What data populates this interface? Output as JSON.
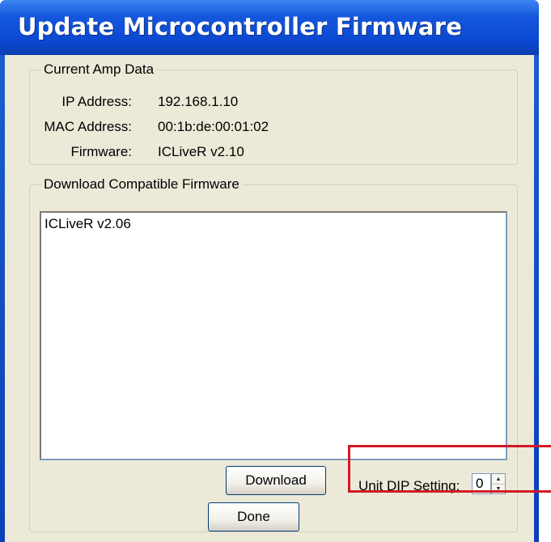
{
  "window": {
    "title": "Update Microcontroller Firmware"
  },
  "amp_group": {
    "legend": "Current Amp Data",
    "rows": [
      {
        "label": "IP Address:",
        "value": "192.168.1.10"
      },
      {
        "label": "MAC Address:",
        "value": "00:1b:de:00:01:02"
      },
      {
        "label": "Firmware:",
        "value": "ICLiveR v2.10"
      }
    ]
  },
  "download_group": {
    "legend": "Download Compatible Firmware",
    "list_items": [
      "ICLiveR v2.06"
    ],
    "download_label": "Download",
    "dip_label": "Unit DIP Setting:",
    "dip_value": "0"
  },
  "done_label": "Done",
  "colors": {
    "title_bar": "#0b48d0",
    "dialog_bg": "#ece9d8",
    "highlight": "#d21a24"
  },
  "icons": {
    "spin_up": "up-arrow",
    "spin_down": "down-arrow"
  }
}
